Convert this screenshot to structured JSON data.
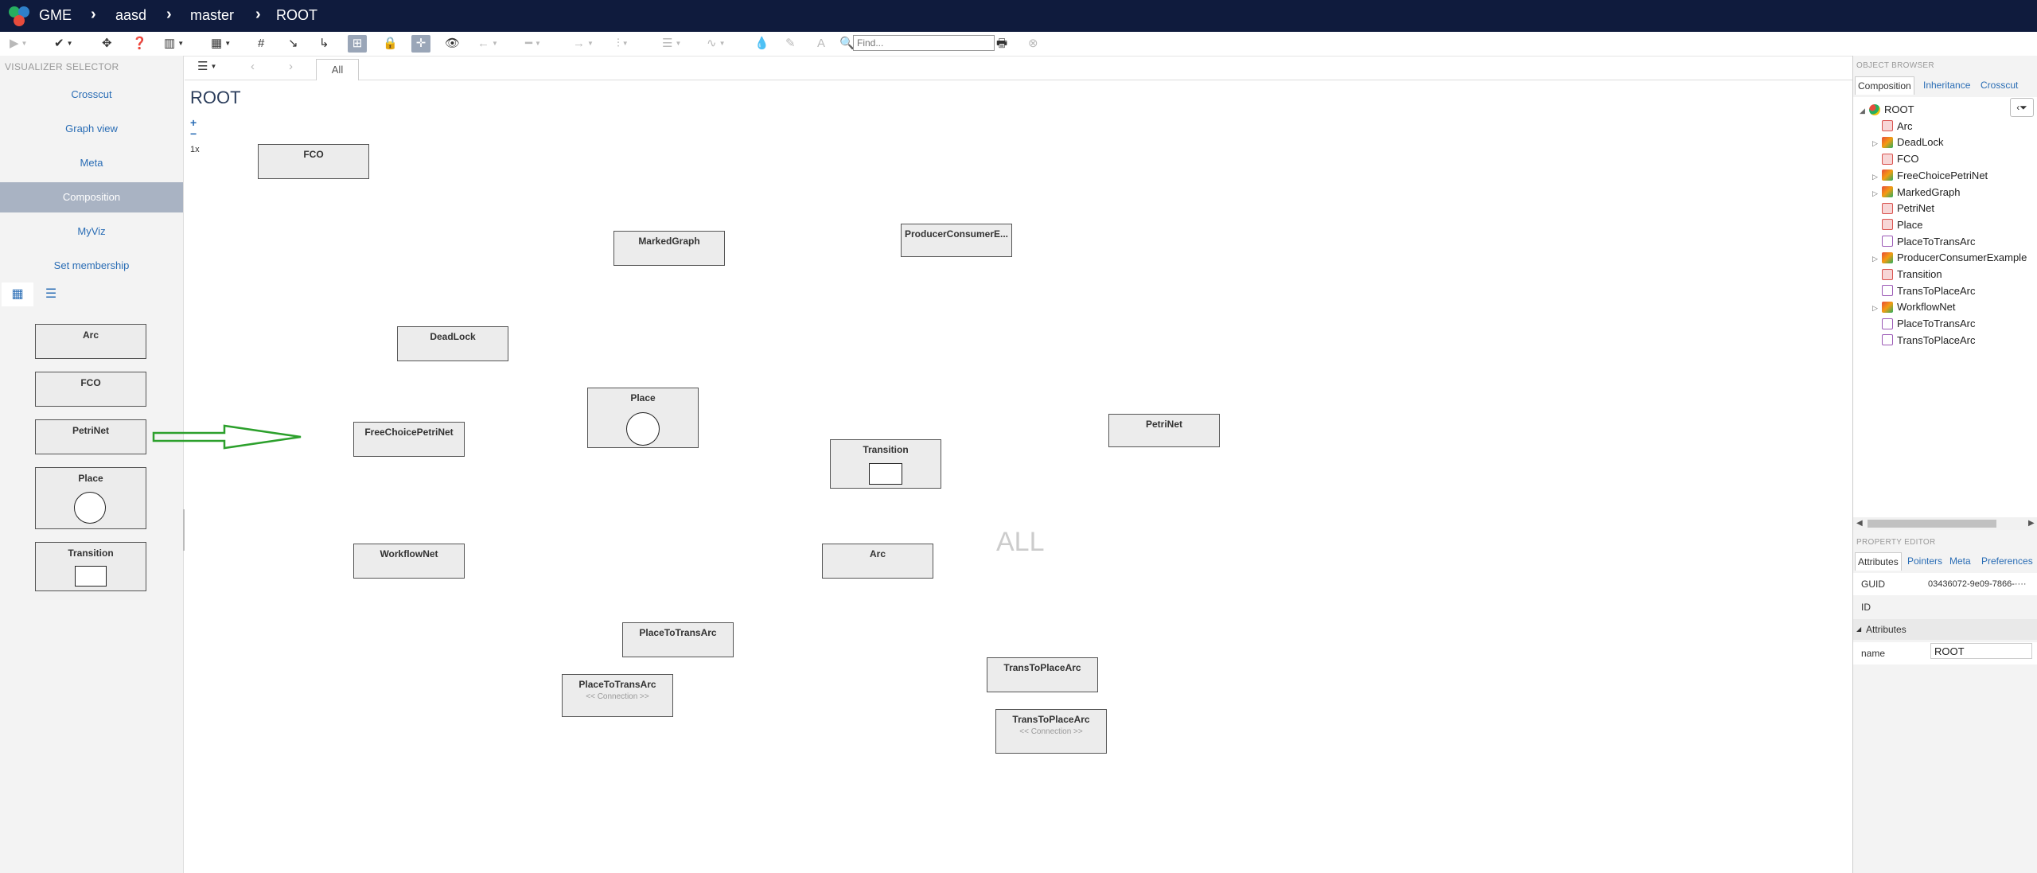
{
  "navbar": {
    "app_name": "GME",
    "project": "aasd",
    "branch": "master",
    "node": "ROOT",
    "separator": "›"
  },
  "toolbar": {
    "find_placeholder": "Find..."
  },
  "left_panel": {
    "title": "VISUALIZER SELECTOR",
    "visualizers": [
      "Crosscut",
      "Graph view",
      "Meta",
      "Composition",
      "MyViz",
      "Set membership"
    ],
    "active_visualizer": "Composition",
    "palette": [
      "Arc",
      "FCO",
      "PetriNet",
      "Place",
      "Transition"
    ]
  },
  "center": {
    "tab_label": "All",
    "title": "ROOT",
    "zoom_in": "+",
    "zoom_out": "−",
    "zoom_level": "1x",
    "watermark": "ALL",
    "boxes": {
      "fco": "FCO",
      "markedgraph": "MarkedGraph",
      "producer": "ProducerConsumerE...",
      "deadlock": "DeadLock",
      "place": "Place",
      "freechoice": "FreeChoicePetriNet",
      "transition": "Transition",
      "petrinet": "PetriNet",
      "workflownet": "WorkflowNet",
      "arc": "Arc",
      "placetotransarc": "PlaceToTransArc",
      "placetotransarc_conn": "PlaceToTransArc",
      "placetotransarc_conn_sub": "<< Connection >>",
      "transtoplacearc": "TransToPlaceArc",
      "transtoplacearc_conn": "TransToPlaceArc",
      "transtoplacearc_conn_sub": "<< Connection >>"
    }
  },
  "object_browser": {
    "title": "OBJECT BROWSER",
    "tabs": [
      "Composition",
      "Inheritance",
      "Crosscut"
    ],
    "active_tab": "Composition",
    "tree": [
      {
        "label": "ROOT",
        "type": "root",
        "expand": "◢",
        "depth": 0
      },
      {
        "label": "Arc",
        "type": "atom",
        "expand": "",
        "depth": 1
      },
      {
        "label": "DeadLock",
        "type": "model",
        "expand": "▷",
        "depth": 1
      },
      {
        "label": "FCO",
        "type": "atom",
        "expand": "",
        "depth": 1
      },
      {
        "label": "FreeChoicePetriNet",
        "type": "model",
        "expand": "▷",
        "depth": 1
      },
      {
        "label": "MarkedGraph",
        "type": "model",
        "expand": "▷",
        "depth": 1
      },
      {
        "label": "PetriNet",
        "type": "atom",
        "expand": "",
        "depth": 1
      },
      {
        "label": "Place",
        "type": "atom",
        "expand": "",
        "depth": 1
      },
      {
        "label": "PlaceToTransArc",
        "type": "conn",
        "expand": "",
        "depth": 1
      },
      {
        "label": "ProducerConsumerExample",
        "type": "model",
        "expand": "▷",
        "depth": 1
      },
      {
        "label": "Transition",
        "type": "atom",
        "expand": "",
        "depth": 1
      },
      {
        "label": "TransToPlaceArc",
        "type": "conn",
        "expand": "",
        "depth": 1
      },
      {
        "label": "WorkflowNet",
        "type": "model",
        "expand": "▷",
        "depth": 1
      },
      {
        "label": "PlaceToTransArc",
        "type": "conn",
        "expand": "",
        "depth": 1
      },
      {
        "label": "TransToPlaceArc",
        "type": "conn",
        "expand": "",
        "depth": 1
      }
    ]
  },
  "property_editor": {
    "title": "PROPERTY EDITOR",
    "tabs": [
      "Attributes",
      "Pointers",
      "Meta",
      "Preferences"
    ],
    "active_tab": "Attributes",
    "guid_label": "GUID",
    "guid_value": "03436072-9e09-7866-····",
    "id_label": "ID",
    "group_label": "Attributes",
    "name_label": "name",
    "name_value": "ROOT"
  },
  "colors": {
    "navbar_bg": "#0f1b3d",
    "link": "#2a6db5",
    "active_item_bg": "#a9b3c3",
    "arrow_green": "#2ca02c"
  }
}
